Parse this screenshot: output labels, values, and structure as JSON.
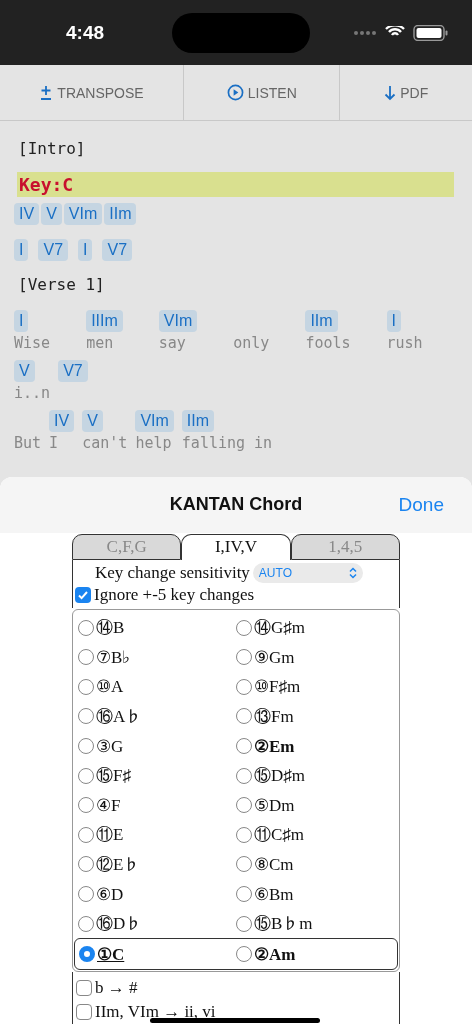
{
  "status_bar": {
    "time": "4:48"
  },
  "toolbar": [
    {
      "kind": "transpose",
      "label": "TRANSPOSE"
    },
    {
      "kind": "listen",
      "label": "LISTEN"
    },
    {
      "kind": "download",
      "label": "PDF"
    }
  ],
  "sheet_music": [
    {
      "kind": "section",
      "text": "[Intro]"
    },
    {
      "kind": "key",
      "text": "Key:C"
    },
    {
      "kind": "chords",
      "segments": [
        {
          "chord": "IV"
        },
        {
          "chord": "V"
        },
        {
          "chord": "VIm"
        },
        {
          "chord": "IIm"
        }
      ]
    },
    {
      "kind": "chords",
      "segments": [
        {
          "chord": "I"
        },
        {
          "chord": "V7"
        },
        {
          "chord": "I"
        },
        {
          "chord": "V7"
        }
      ]
    },
    {
      "kind": "section",
      "text": "[Verse 1]"
    },
    {
      "kind": "lyrics",
      "segments": [
        {
          "chord": "I",
          "lyric": "Wise"
        },
        {
          "chord": "IIIm",
          "lyric": "men"
        },
        {
          "chord": "VIm",
          "lyric": "say"
        },
        {
          "lyric": "only"
        },
        {
          "chord": "IIm",
          "lyric": "fools"
        },
        {
          "chord": "I",
          "lyric": "rush"
        }
      ]
    },
    {
      "kind": "lyrics",
      "segments": [
        {
          "chord": "V",
          "lyric": "i..n"
        },
        {
          "chord": "V7"
        }
      ]
    },
    {
      "kind": "lyrics",
      "segments": [
        {
          "lyric": "But"
        },
        {
          "chord": "IV",
          "lyric": "I"
        },
        {
          "chord": "V",
          "lyric": "can't"
        },
        {
          "chord": "VIm",
          "lyric": "help"
        },
        {
          "chord": "IIm",
          "lyric": "falling in"
        }
      ]
    }
  ],
  "sheet": {
    "title": "KANTAN Chord",
    "done": "Done",
    "tabs": [
      {
        "label": "C,F,G",
        "selected": false
      },
      {
        "label": "I,IV,V",
        "selected": true
      },
      {
        "label": "1,4,5",
        "selected": false
      }
    ],
    "sensitivity": {
      "label": "Key change sensitivity",
      "value": "AUTO"
    },
    "ignore": {
      "label": "Ignore +-5 key changes",
      "checked": true
    },
    "keys": [
      [
        {
          "label": "⑭B",
          "selected": false,
          "kind": "plain"
        },
        {
          "label": "⑭G♯m",
          "selected": false,
          "kind": "plain"
        }
      ],
      [
        {
          "label": "⑦B♭",
          "selected": false,
          "kind": "plain"
        },
        {
          "label": "⑨Gm",
          "selected": false,
          "kind": "plain"
        }
      ],
      [
        {
          "label": "⑩A",
          "selected": false,
          "kind": "plain"
        },
        {
          "label": "⑩F♯m",
          "selected": false,
          "kind": "plain"
        }
      ],
      [
        {
          "label": "⑯A♭",
          "selected": false,
          "kind": "plain"
        },
        {
          "label": "⑬Fm",
          "selected": false,
          "kind": "plain"
        }
      ],
      [
        {
          "label": "③G",
          "selected": false,
          "kind": "plain"
        },
        {
          "label": "②Em",
          "selected": false,
          "kind": "bold"
        }
      ],
      [
        {
          "label": "⑮F♯",
          "selected": false,
          "kind": "plain"
        },
        {
          "label": "⑮D♯m",
          "selected": false,
          "kind": "plain"
        }
      ],
      [
        {
          "label": "④F",
          "selected": false,
          "kind": "plain"
        },
        {
          "label": "⑤Dm",
          "selected": false,
          "kind": "plain"
        }
      ],
      [
        {
          "label": "⑪E",
          "selected": false,
          "kind": "plain"
        },
        {
          "label": "⑪C♯m",
          "selected": false,
          "kind": "plain"
        }
      ],
      [
        {
          "label": "⑫E♭",
          "selected": false,
          "kind": "plain"
        },
        {
          "label": "⑧Cm",
          "selected": false,
          "kind": "plain"
        }
      ],
      [
        {
          "label": "⑥D",
          "selected": false,
          "kind": "plain"
        },
        {
          "label": "⑥Bm",
          "selected": false,
          "kind": "plain"
        }
      ],
      [
        {
          "label": "⑯D♭",
          "selected": false,
          "kind": "plain"
        },
        {
          "label": "⑮B♭m",
          "selected": false,
          "kind": "plain"
        }
      ],
      [
        {
          "label": "①C",
          "selected": true,
          "kind": "underline"
        },
        {
          "label": "②Am",
          "selected": false,
          "kind": "bold"
        }
      ]
    ],
    "options": [
      {
        "label": "b → #",
        "checked": false
      },
      {
        "label": "IIm, VIm → ii, vi",
        "checked": false
      }
    ]
  }
}
